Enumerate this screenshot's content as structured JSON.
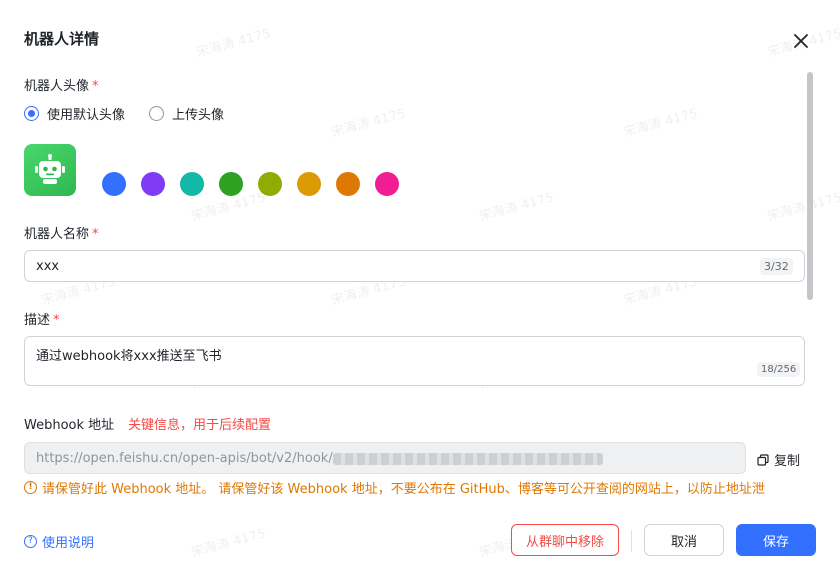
{
  "dialog": {
    "title": "机器人详情"
  },
  "avatar_section": {
    "label": "机器人头像",
    "required_mark": "*",
    "options": [
      {
        "label": "使用默认头像",
        "checked": true
      },
      {
        "label": "上传头像",
        "checked": false
      }
    ],
    "avatar_icon": "robot-icon",
    "avatar_color": "#34c759",
    "swatch_colors": [
      "#3370ff",
      "#7f3bf5",
      "#14b8a6",
      "#2ea121",
      "#8fac02",
      "#dc9b04",
      "#de7802",
      "#f01d94"
    ]
  },
  "name_section": {
    "label": "机器人名称",
    "required_mark": "*",
    "value": "xxx",
    "counter": "3/32"
  },
  "desc_section": {
    "label": "描述",
    "required_mark": "*",
    "value": "通过webhook将xxx推送至飞书",
    "counter": "18/256"
  },
  "webhook_section": {
    "label": "Webhook 地址",
    "hint": "关键信息，用于后续配置",
    "url_prefix": "https://open.feishu.cn/open-apis/bot/v2/hook/",
    "copy_label": "复制",
    "warning": "请保管好此 Webhook 地址。 请保管好该 Webhook 地址，不要公布在 GitHub、博客等可公开查阅的网站上，以防止地址泄"
  },
  "footer": {
    "help_label": "使用说明",
    "remove_label": "从群聊中移除",
    "cancel_label": "取消",
    "save_label": "保存"
  },
  "watermark": "宋海涛 4175",
  "colors": {
    "primary": "#3370ff",
    "danger": "#f54a45",
    "warning": "#de7802"
  }
}
